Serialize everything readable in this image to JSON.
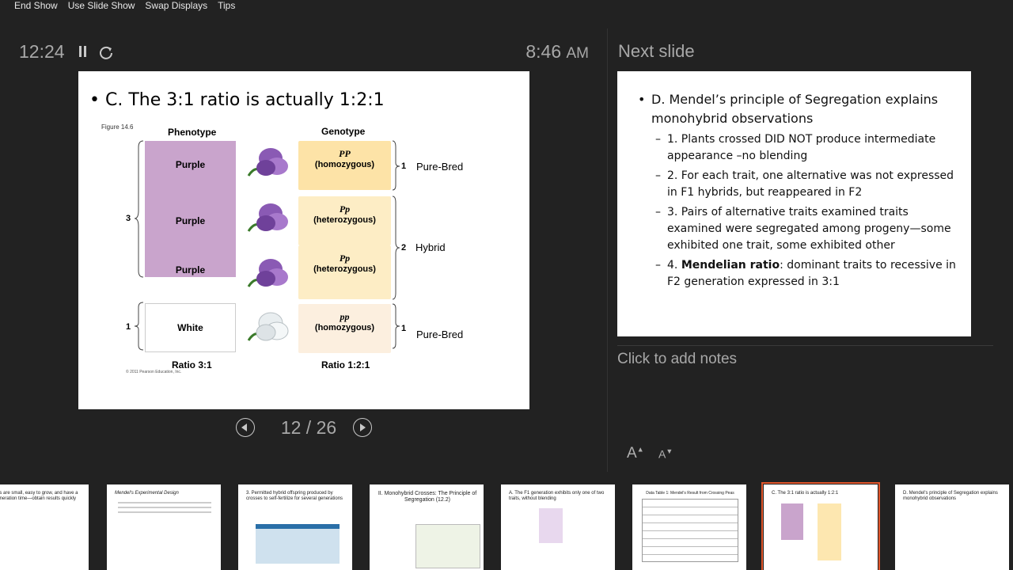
{
  "menubar": {
    "items": [
      "End Show",
      "Use Slide Show",
      "Swap Displays",
      "Tips"
    ]
  },
  "timer": {
    "elapsed": "12:24",
    "clock": "8:46",
    "clock_ampm": "AM"
  },
  "navigation": {
    "current": "12",
    "total": "26",
    "counter": "12 / 26"
  },
  "current_slide": {
    "title": "C. The 3:1 ratio is actually 1:2:1",
    "figure_label": "Figure 14.6",
    "phenotype_header": "Phenotype",
    "genotype_header": "Genotype",
    "phenotypes": [
      "Purple",
      "Purple",
      "Purple",
      "White"
    ],
    "genotypes": [
      {
        "symbol": "PP",
        "type": "(homozygous)"
      },
      {
        "symbol": "Pp",
        "type": "(heterozygous)"
      },
      {
        "symbol": "Pp",
        "type": "(heterozygous)"
      },
      {
        "symbol": "pp",
        "type": "(homozygous)"
      }
    ],
    "left_counts": [
      "3",
      "1"
    ],
    "right_counts": [
      "1",
      "2",
      "1"
    ],
    "right_labels": [
      "Pure-Bred",
      "Hybrid",
      "Pure-Bred"
    ],
    "ratio_pheno": "Ratio 3:1",
    "ratio_geno": "Ratio 1:2:1",
    "copyright": "© 2011 Pearson Education, Inc."
  },
  "next_slide": {
    "label": "Next slide",
    "bullet": "D. Mendel’s principle of Segregation explains monohybrid observations",
    "subs": [
      "1. Plants crossed DID NOT produce intermediate appearance –no blending",
      "2. For each trait, one alternative was not expressed in F1 hybrids, but reappeared in F2",
      "3. Pairs of alternative traits examined traits examined were segregated among progeny—some exhibited one trait, some exhibited other"
    ],
    "sub4_bold": "Mendelian ratio",
    "sub4_prefix": "4. ",
    "sub4_rest": ": dominant traits to recessive in F2 generation expressed in 3:1"
  },
  "notes": {
    "placeholder": "Click to add notes"
  },
  "font_controls": {
    "increase": "A",
    "decrease": "A"
  },
  "filmstrip": {
    "thumbs": [
      {
        "title": "ea plants are small, easy to grow, and have a short generation time—obtain results quickly"
      },
      {
        "title": "Mendel's Experimental Design"
      },
      {
        "title": "3. Permitted hybrid offspring produced by crosses to self-fertilize for several generations"
      },
      {
        "title": "II. Monohybrid Crosses: The Principle of Segregation (12.2)"
      },
      {
        "title": "A. The F1 generation exhibits only one of two traits, without blending"
      },
      {
        "title": "Data Table 1: Mendel's Result from Crossing Peas"
      },
      {
        "title": "C. The 3:1 ratio is actually 1:2:1"
      },
      {
        "title": "D. Mendel's principle of Segregation explains monohybrid observations"
      }
    ],
    "selected_index": 6
  },
  "colors": {
    "background": "#222222",
    "selected_outline": "#e0552b",
    "purple": "#c9a4cc",
    "genotype_fill": "#fde7b0"
  }
}
